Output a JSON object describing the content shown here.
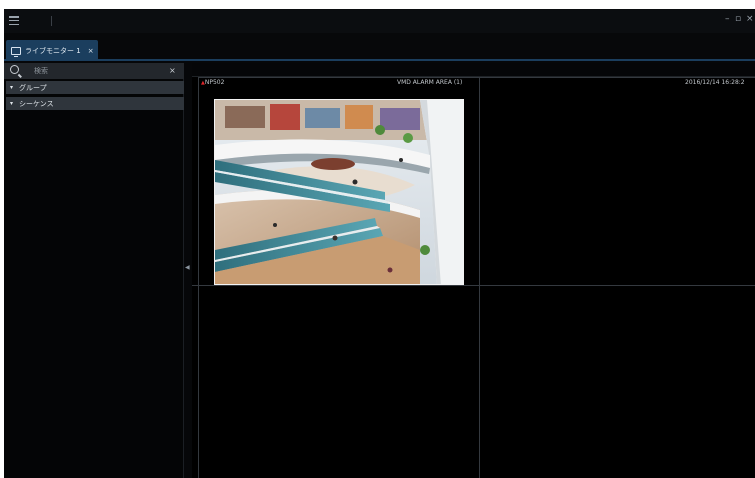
{
  "window": {
    "controls": {
      "minimize": "–",
      "maximize": "▫",
      "close": "×"
    }
  },
  "tabs": [
    {
      "label": "ライブモニター 1",
      "close": "×",
      "icon": "monitor-icon"
    }
  ],
  "sidebar": {
    "search": {
      "placeholder": "検索",
      "value": "",
      "clear": "×"
    },
    "tree": [
      {
        "label": "グループ",
        "chevron": "▾"
      },
      {
        "label": "シーケンス",
        "chevron": "▾"
      }
    ],
    "collapse_arrow": "◀"
  },
  "camera": {
    "name": "NP502",
    "event": "VMD ALARM AREA (1)",
    "timestamp": "2016/12/14 16:28:2",
    "rec_marker": "▲",
    "video_subject": "shopping-mall-escalators"
  },
  "colors": {
    "background": "#000000",
    "tab_active": "#1b3e5e",
    "tree_row": "#2f353c",
    "grid_line": "#34393f",
    "rec_red": "#e0262a"
  }
}
